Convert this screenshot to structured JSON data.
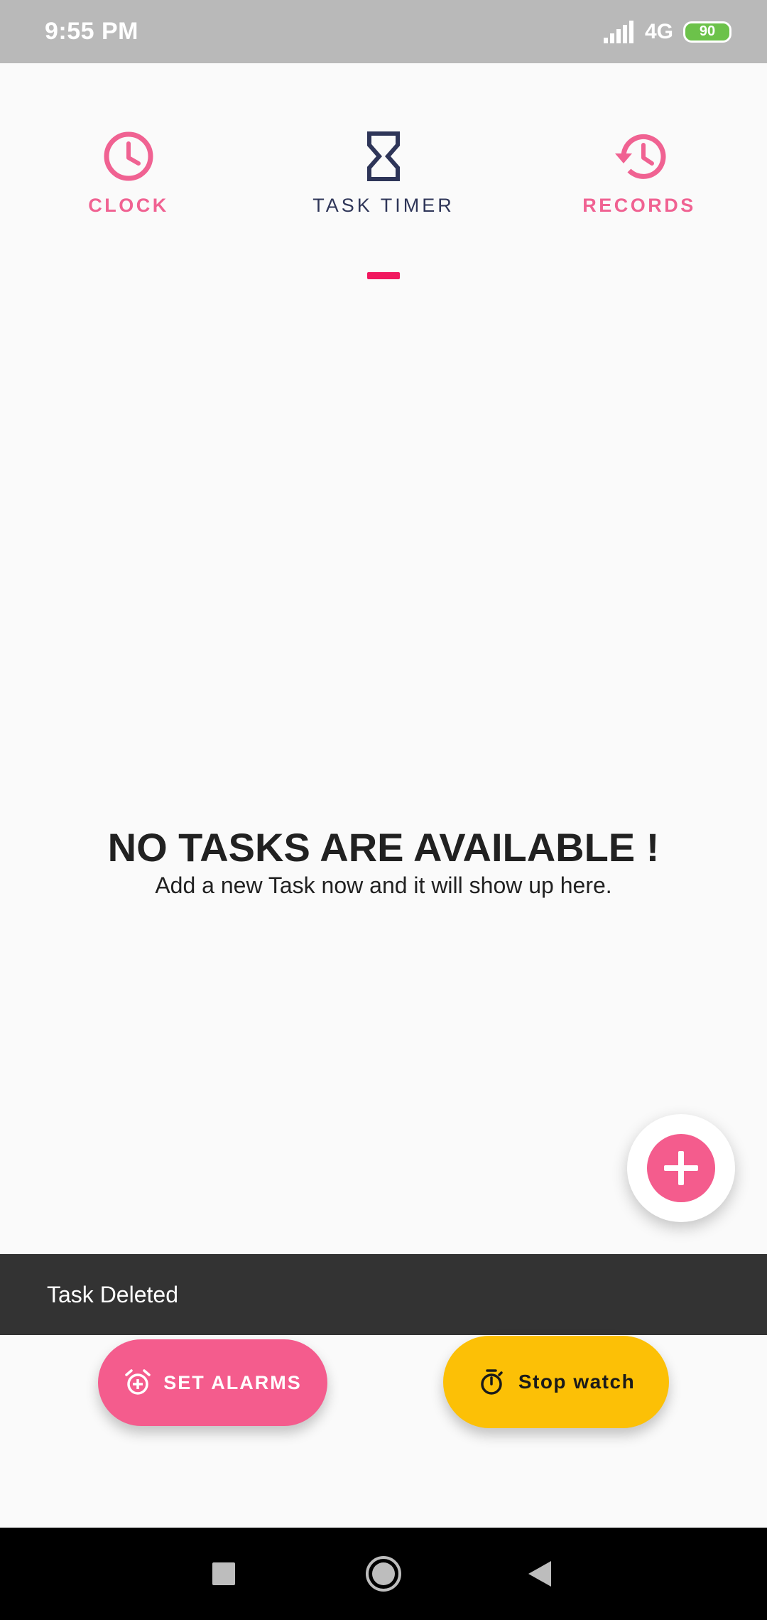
{
  "status_bar": {
    "time": "9:55 PM",
    "network": "4G",
    "battery": "90",
    "icons": [
      "signal-icon",
      "battery-icon"
    ]
  },
  "tabs": [
    {
      "label": "CLOCK",
      "icon": "clock-icon",
      "active": false
    },
    {
      "label": "TASK TIMER",
      "icon": "hourglass-icon",
      "active": true
    },
    {
      "label": "RECORDS",
      "icon": "history-icon",
      "active": false
    }
  ],
  "empty_state": {
    "title": "NO TASKS ARE AVAILABLE !",
    "subtitle": "Add a new Task now and it will show up here."
  },
  "fab": {
    "icon": "plus-icon"
  },
  "snackbar": {
    "message": "Task Deleted"
  },
  "actions": {
    "set_alarms": {
      "label": "SET ALARMS",
      "icon": "alarm-add-icon"
    },
    "stopwatch": {
      "label": "Stop watch",
      "icon": "timer-icon"
    }
  },
  "nav": {
    "icons": [
      "recents-icon",
      "home-icon",
      "back-icon"
    ]
  },
  "colors": {
    "accent_pink": "#f45c8d",
    "indicator": "#f1185f",
    "active_tab_text": "#2e3558",
    "stopwatch_yellow": "#fcc006",
    "snackbar_bg": "#333333",
    "status_bar_bg": "#b9b9b9"
  }
}
